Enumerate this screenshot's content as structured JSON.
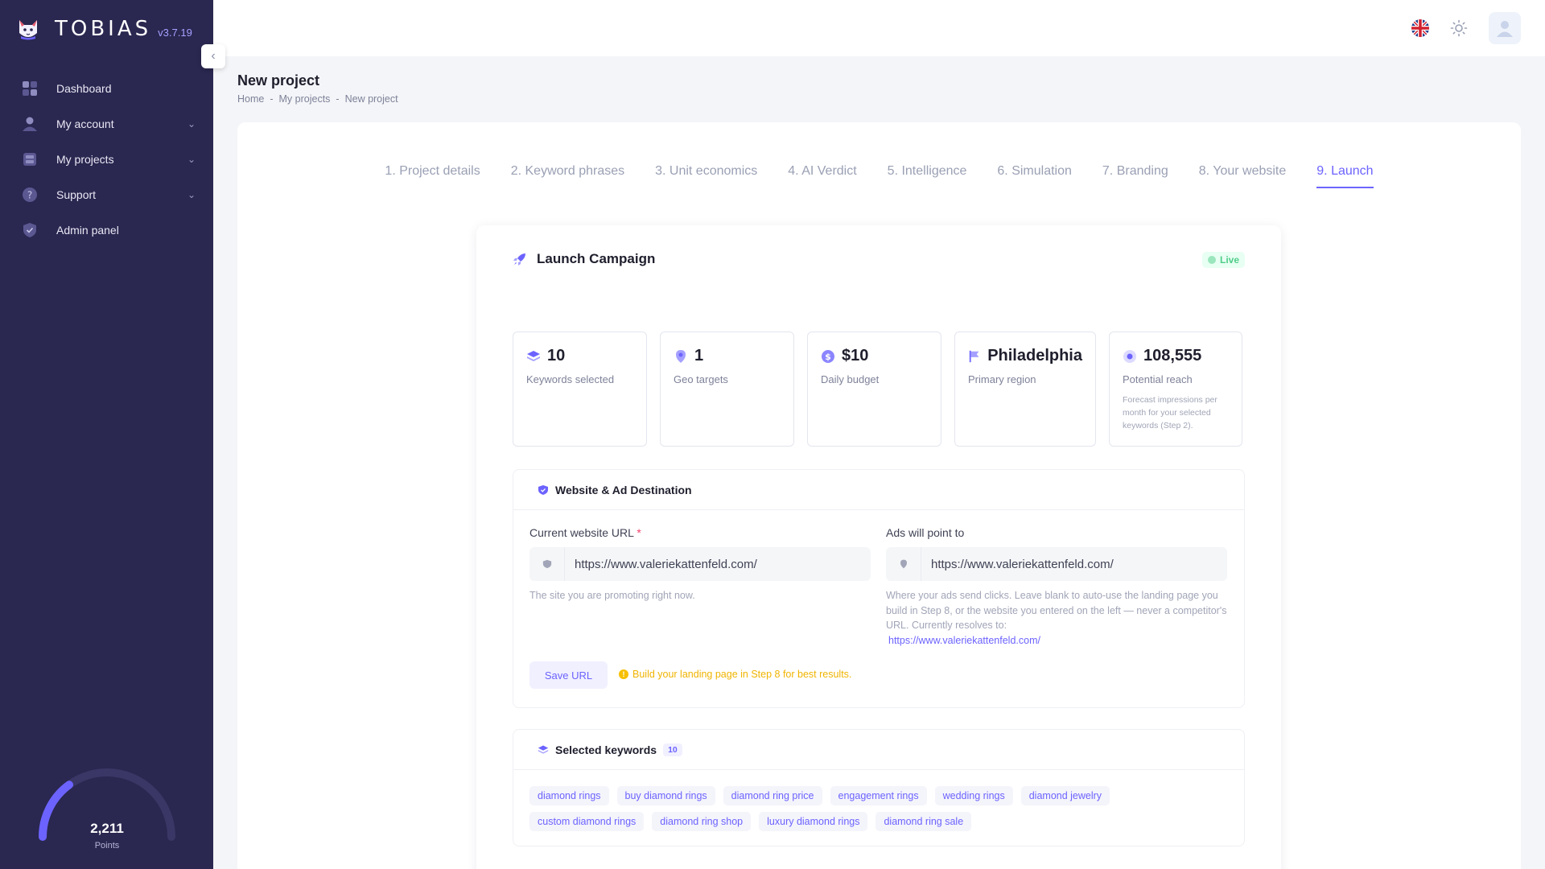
{
  "app": {
    "name": "TOBIAS",
    "version": "v3.7.19"
  },
  "sidebar": {
    "items": [
      {
        "label": "Dashboard",
        "icon": "dashboard-icon",
        "has_children": false
      },
      {
        "label": "My account",
        "icon": "user-icon",
        "has_children": true
      },
      {
        "label": "My projects",
        "icon": "projects-icon",
        "has_children": true
      },
      {
        "label": "Support",
        "icon": "help-icon",
        "has_children": true
      },
      {
        "label": "Admin panel",
        "icon": "shield-icon",
        "has_children": false
      }
    ],
    "points": {
      "value": "2,211",
      "label": "Points",
      "progress": 0.3
    }
  },
  "page": {
    "title": "New project",
    "breadcrumb": [
      "Home",
      "My projects",
      "New project"
    ]
  },
  "steps": [
    "1. Project details",
    "2. Keyword phrases",
    "3. Unit economics",
    "4. AI Verdict",
    "5. Intelligence",
    "6. Simulation",
    "7. Branding",
    "8. Your website",
    "9. Launch"
  ],
  "active_step": 8,
  "launch": {
    "title": "Launch Campaign",
    "status": "Live",
    "stats": [
      {
        "value": "10",
        "label": "Keywords selected",
        "icon": "layers-icon"
      },
      {
        "value": "1",
        "label": "Geo targets",
        "icon": "map-pin-icon"
      },
      {
        "value": "$10",
        "label": "Daily budget",
        "icon": "dollar-icon"
      },
      {
        "value": "Philadelphia",
        "label": "Primary region",
        "icon": "flag-icon"
      },
      {
        "value": "108,555",
        "label": "Potential reach",
        "icon": "eye-icon",
        "note": "Forecast impressions per month for your selected keywords (Step 2)."
      }
    ]
  },
  "website": {
    "title": "Website & Ad Destination",
    "current_label": "Current website URL",
    "required_mark": "*",
    "current_value": "https://www.valeriekattenfeld.com/",
    "current_help": "The site you are promoting right now.",
    "ads_label": "Ads will point to",
    "ads_value": "https://www.valeriekattenfeld.com/",
    "ads_help": "Where your ads send clicks. Leave blank to auto-use the landing page you build in Step 8, or the website you entered on the left — never a competitor's URL. Currently resolves to:",
    "ads_resolved": "https://www.valeriekattenfeld.com/",
    "save_label": "Save URL",
    "hint": "Build your landing page in Step 8 for best results."
  },
  "keywords": {
    "title": "Selected keywords",
    "count": "10",
    "items": [
      "diamond rings",
      "buy diamond rings",
      "diamond ring price",
      "engagement rings",
      "wedding rings",
      "diamond jewelry",
      "custom diamond rings",
      "diamond ring shop",
      "luxury diamond rings",
      "diamond ring sale"
    ]
  },
  "colors": {
    "sidebar": "#2a2750",
    "accent": "#6c63ff",
    "live": "#50cd89",
    "warning": "#f0b400"
  }
}
